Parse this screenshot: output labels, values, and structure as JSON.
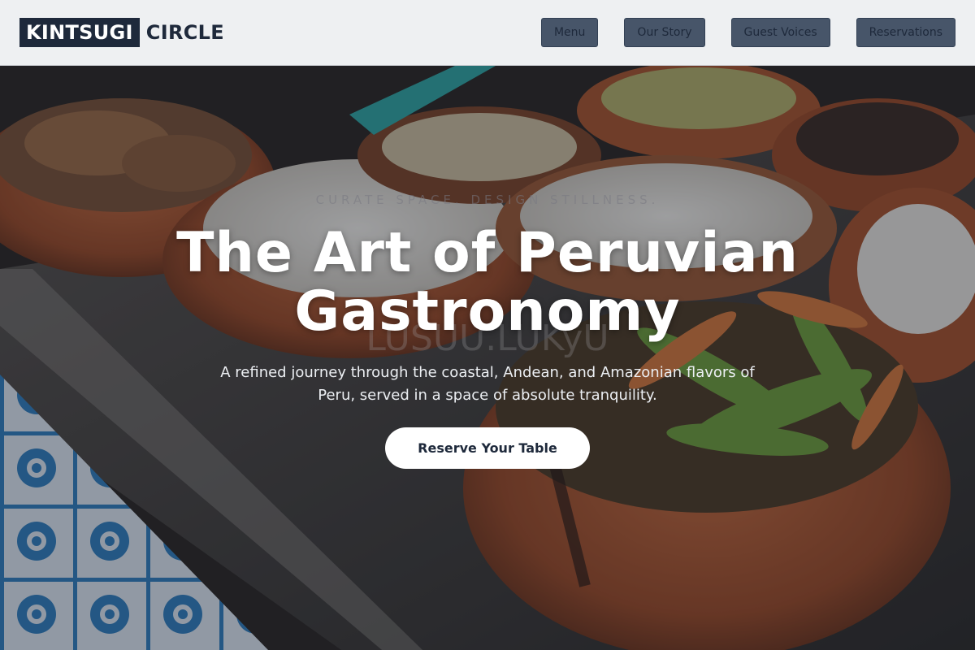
{
  "brand": {
    "box_text": "KINTSUGI",
    "text": "CIRCLE"
  },
  "nav": {
    "items": [
      {
        "label": "Menu"
      },
      {
        "label": "Our Story"
      },
      {
        "label": "Guest Voices"
      },
      {
        "label": "Reservations"
      }
    ]
  },
  "hero": {
    "eyebrow": "CURATE SPACE. DESIGN STILLNESS.",
    "ghost": "LUSUU.LUKyU",
    "title_line1": "The Art of Peruvian",
    "title_line2": "Gastronomy",
    "subtitle": "A refined journey through the coastal, Andean, and Amazonian flavors of Peru, served in a space of absolute tranquility.",
    "cta_label": "Reserve Your Table"
  },
  "colors": {
    "brand_dark": "#1e293b",
    "nav_button": "#475569",
    "cta_bg": "#ffffff",
    "header_bg": "#eef0f2"
  },
  "icons": [
    "hero-food-photo"
  ]
}
